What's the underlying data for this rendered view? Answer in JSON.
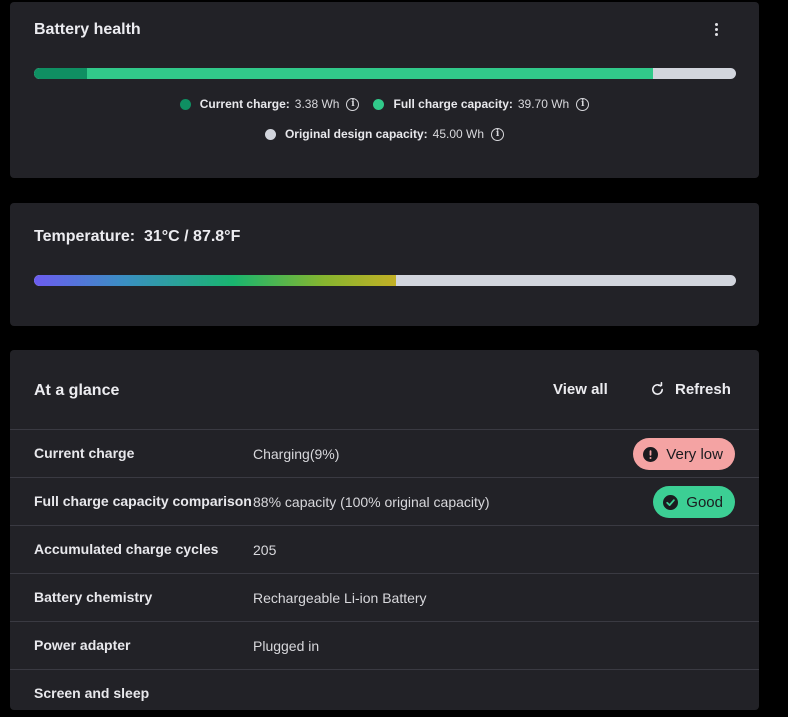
{
  "battery_health": {
    "title": "Battery health",
    "current_charge_wh": 3.38,
    "full_charge_wh": 39.7,
    "design_capacity_wh": 45.0,
    "legend": [
      {
        "label": "Current charge:",
        "value": "3.38 Wh",
        "color": "#0f8f62"
      },
      {
        "label": "Full charge capacity:",
        "value": "39.70 Wh",
        "color": "#31c98a"
      },
      {
        "label": "Original design capacity:",
        "value": "45.00 Wh",
        "color": "#d2d5dd"
      }
    ]
  },
  "temperature": {
    "label": "Temperature:",
    "value": "31°C / 87.8°F",
    "level_fraction": 0.516
  },
  "glance": {
    "title": "At a glance",
    "view_all_label": "View all",
    "refresh_label": "Refresh",
    "rows": [
      {
        "label": "Current charge",
        "value": "Charging(9%)",
        "badge": {
          "text": "Very low",
          "bg": "#f4a3a3",
          "icon": "exclamation-icon"
        }
      },
      {
        "label": "Full charge capacity comparison",
        "value": "88% capacity (100% original capacity)",
        "badge": {
          "text": "Good",
          "bg": "#3ccf94",
          "icon": "checkmark-icon"
        }
      },
      {
        "label": "Accumulated charge cycles",
        "value": "205"
      },
      {
        "label": "Battery chemistry",
        "value": "Rechargeable Li-ion Battery"
      },
      {
        "label": "Power adapter",
        "value": "Plugged in"
      },
      {
        "label": "Screen and sleep",
        "value": ""
      }
    ]
  },
  "colors": {
    "background": "#000000",
    "card": "#222227",
    "accent_green": "#31c98a",
    "track": "#d2d5dd"
  }
}
